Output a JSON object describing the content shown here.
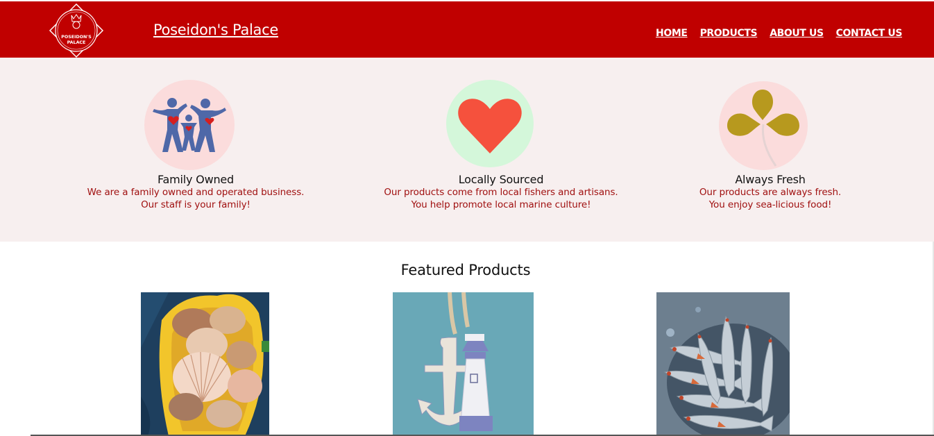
{
  "header": {
    "brand": "Poseidon's Palace",
    "logo_text_1": "POSEIDON'S",
    "logo_text_2": "PALACE",
    "nav": [
      "HOME",
      "PRODUCTS",
      "ABOUT US",
      "CONTACT US"
    ],
    "bg_color": "#c00000"
  },
  "features": [
    {
      "icon": "family-icon",
      "title": "Family Owned",
      "line1": "We are a family owned and operated business.",
      "line2": "Our staff is your family!",
      "circle_color": "#fbdcdc"
    },
    {
      "icon": "heart-icon",
      "title": "Locally Sourced",
      "line1": "Our products come from local fishers and artisans.",
      "line2": "You help promote local marine culture!",
      "circle_color": "#d4f7da"
    },
    {
      "icon": "leaf-icon",
      "title": "Always Fresh",
      "line1": "Our products are always fresh.",
      "line2": "You enjoy sea-licious food!",
      "circle_color": "#fbdcdc"
    }
  ],
  "featured": {
    "title": "Featured Products",
    "products": [
      {
        "image": "scallop-shells-image"
      },
      {
        "image": "anchor-lighthouse-decor-image"
      },
      {
        "image": "fresh-fish-image"
      }
    ]
  }
}
